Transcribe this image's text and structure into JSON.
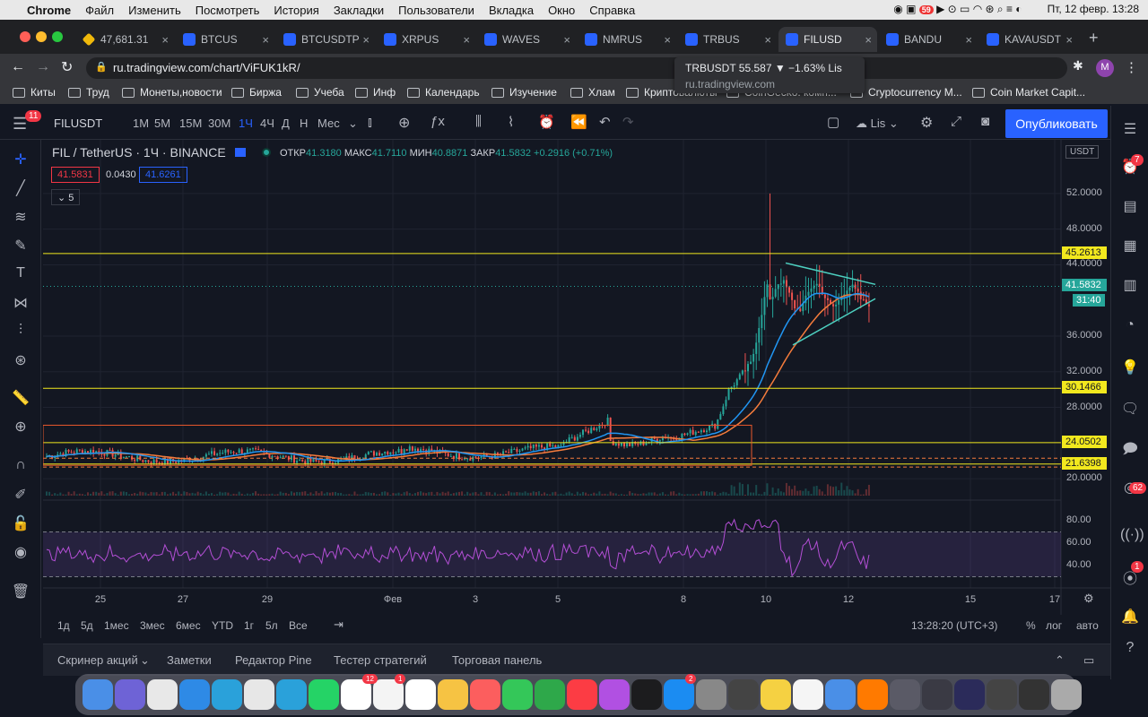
{
  "os_menu": {
    "app": "Chrome",
    "items": [
      "Файл",
      "Изменить",
      "Посмотреть",
      "История",
      "Закладки",
      "Пользователи",
      "Вкладка",
      "Окно",
      "Справка"
    ],
    "clock": "Пт, 12 февр.  13:28",
    "notif_count": "59"
  },
  "tabs": [
    {
      "label": "47,681.31",
      "icon": "binance-icon"
    },
    {
      "label": "BTCUS",
      "icon": "tv-icon"
    },
    {
      "label": "BTCUSDTP",
      "icon": "tv-icon"
    },
    {
      "label": "XRPUS",
      "icon": "tv-icon"
    },
    {
      "label": "WAVES",
      "icon": "tv-icon"
    },
    {
      "label": "NMRUS",
      "icon": "tv-icon"
    },
    {
      "label": "TRBUS",
      "icon": "tv-icon"
    },
    {
      "label": "FILUSD",
      "icon": "tv-icon",
      "active": true
    },
    {
      "label": "BANDU",
      "icon": "tv-icon"
    },
    {
      "label": "KAVAUSDT",
      "icon": "tv-icon"
    }
  ],
  "url": "ru.tradingview.com/chart/ViFUK1kR/",
  "tooltip": {
    "title": "TRBUSDT 55.587 ▼ −1.63% Lis",
    "url": "ru.tradingview.com"
  },
  "bookmarks": [
    "Киты",
    "Труд",
    "Монеты,новости",
    "Биржа",
    "Учеба",
    "Инф",
    "Календарь",
    "Изучение",
    "Хлам",
    "Криптовалюты",
    "CoinGecko: комп...",
    "Cryptocurrency M...",
    "Coin Market Capit..."
  ],
  "toolbar": {
    "symbol": "FILUSDT",
    "intervals": [
      "1М",
      "5М",
      "15М",
      "30М",
      "1Ч",
      "4Ч",
      "Д",
      "Н",
      "Мес"
    ],
    "active_interval": "1Ч",
    "layout": "Lis",
    "publish": "Опубликовать",
    "alerts_badge": "11"
  },
  "legend": {
    "title": "FIL / TetherUS · 1Ч · BINANCE",
    "open_label": "ОТКР",
    "open": "41.3180",
    "high_label": "МАКС",
    "high": "41.7110",
    "low_label": "МИН",
    "low": "40.8871",
    "close_label": "ЗАКР",
    "close": "41.5832",
    "change": "+0.2916 (+0.71%)",
    "bid": "41.5831",
    "spread": "0.0430",
    "ask": "41.6261",
    "indicators": "5"
  },
  "price_axis": {
    "currency": "USDT",
    "ticks": [
      "52.0000",
      "48.0000",
      "44.0000",
      "36.0000",
      "32.0000",
      "28.0000",
      "20.0000"
    ],
    "last_price": "41.5832",
    "countdown": "31:40",
    "levels": [
      "45.2613",
      "30.1466",
      "24.0502",
      "21.6398"
    ]
  },
  "rsi_axis": [
    "80.00",
    "60.00",
    "40.00"
  ],
  "time_axis": [
    "25",
    "27",
    "29",
    "Фев",
    "3",
    "5",
    "8",
    "10",
    "12",
    "15",
    "17"
  ],
  "chart_data": {
    "type": "candlestick",
    "symbol": "FIL/USDT",
    "interval": "1Ч",
    "last_close": 41.5832,
    "horizontal_levels": [
      45.2613,
      30.1466,
      24.0502,
      21.6398
    ],
    "ylim": [
      18,
      54
    ],
    "rsi_levels": [
      70,
      30
    ]
  },
  "ranges": [
    "1д",
    "5д",
    "1мес",
    "3мес",
    "6мес",
    "YTD",
    "1г",
    "5л",
    "Все"
  ],
  "bottom_right": {
    "time": "13:28:20 (UTC+3)",
    "percent": "%",
    "log": "лог",
    "auto": "авто"
  },
  "panel_tabs": [
    "Скринер акций",
    "Заметки",
    "Редактор Pine",
    "Тестер стратегий",
    "Торговая панель"
  ],
  "right_badges": {
    "ideas": "7",
    "chat": "62",
    "alerts": "1"
  },
  "dock_badges": {
    "calendar": "12",
    "appstore": "2",
    "notes": "1"
  }
}
